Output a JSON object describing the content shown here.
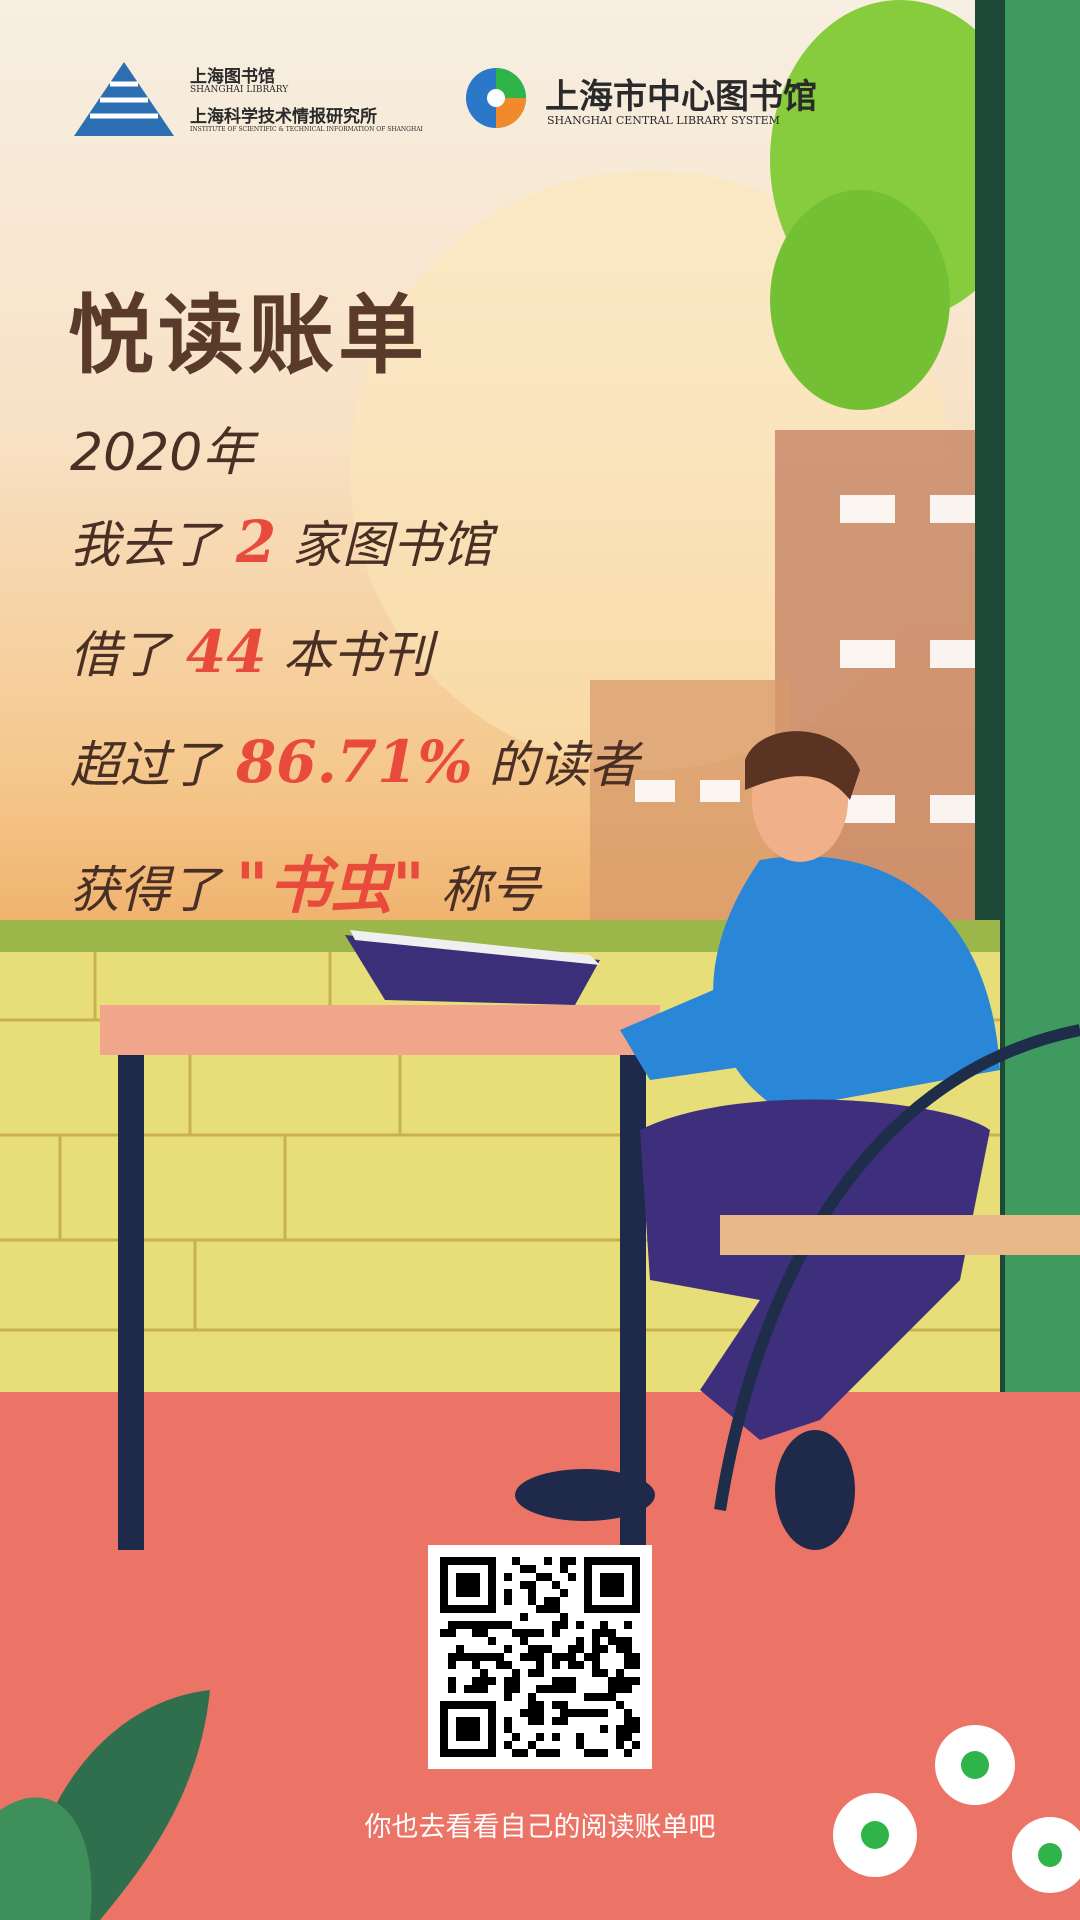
{
  "logos": {
    "left": {
      "cn_name": "上海图书馆",
      "en_name": "SHANGHAI LIBRARY",
      "institute_cn": "上海科学技术情报研究所",
      "institute_en": "INSTITUTE OF SCIENTIFIC & TECHNICAL INFORMATION OF SHANGHAI"
    },
    "right": {
      "cn_name": "上海市中心图书馆",
      "en_name": "SHANGHAI CENTRAL LIBRARY SYSTEM"
    }
  },
  "report": {
    "title": "悦读账单",
    "year": "2020年",
    "libraries_prefix": "我去了",
    "libraries_count": "2",
    "libraries_suffix": "家图书馆",
    "books_prefix": "借了",
    "books_count": "44",
    "books_suffix": "本书刊",
    "rank_prefix": "超过了",
    "rank_percent": "86.71%",
    "rank_suffix": "的读者",
    "badge_prefix": "获得了",
    "badge_title": "\"书虫\"",
    "badge_suffix": "称号"
  },
  "footer": {
    "invite_text": "你也去看看自己的阅读账单吧"
  },
  "colors": {
    "accent": "#e84a3c",
    "text": "#4a2f25"
  }
}
